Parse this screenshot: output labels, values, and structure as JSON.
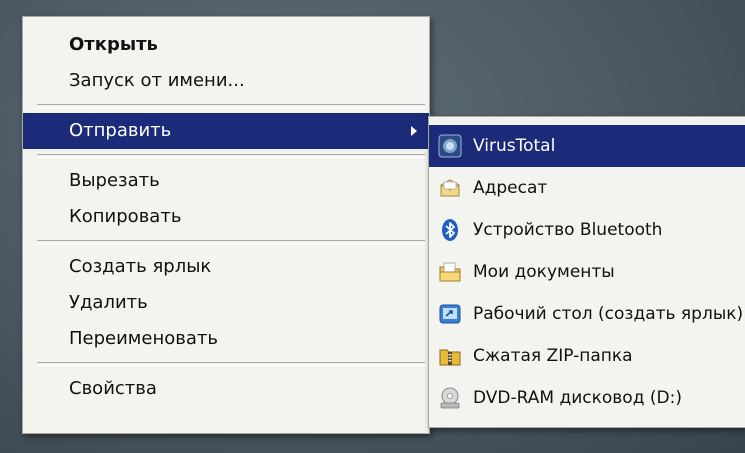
{
  "context_menu": {
    "items": [
      {
        "label": "Открыть"
      },
      {
        "label": "Запуск от имени..."
      },
      {
        "label": "Отправить"
      },
      {
        "label": "Вырезать"
      },
      {
        "label": "Копировать"
      },
      {
        "label": "Создать ярлык"
      },
      {
        "label": "Удалить"
      },
      {
        "label": "Переименовать"
      },
      {
        "label": "Свойства"
      }
    ]
  },
  "send_to_menu": {
    "items": [
      {
        "label": "VirusTotal",
        "icon": "virustotal-icon"
      },
      {
        "label": "Адресат",
        "icon": "mail-recipient-icon"
      },
      {
        "label": "Устройство Bluetooth",
        "icon": "bluetooth-icon"
      },
      {
        "label": "Мои документы",
        "icon": "my-documents-icon"
      },
      {
        "label": "Рабочий стол (создать ярлык)",
        "icon": "desktop-shortcut-icon"
      },
      {
        "label": "Сжатая ZIP-папка",
        "icon": "zip-folder-icon"
      },
      {
        "label": "DVD-RAM дисковод (D:)",
        "icon": "dvd-drive-icon"
      }
    ]
  },
  "colors": {
    "selection": "#1c2a7a",
    "menu_background": "#f3f3f0",
    "desktop_background": "#4a5862"
  }
}
